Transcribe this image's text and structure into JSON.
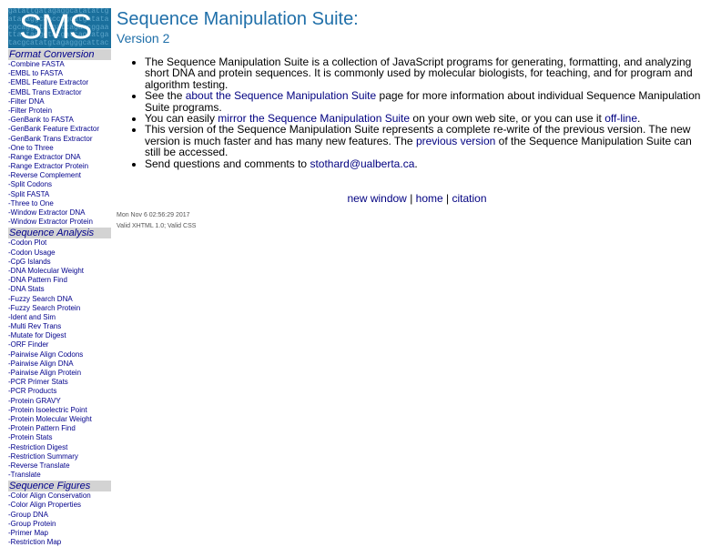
{
  "logo": {
    "text": "SMS",
    "background_sequence": "gatattgatagaggcatatattgatagaggcaaccggcatgatatacgcagggtatgatcagaccggaattattagggtatgatcagcatgatacgcatatgtagagggcattaccagggtagattgag",
    "bg_color": "#1a6f9c"
  },
  "sidebar": {
    "sections": [
      {
        "title": "Format Conversion",
        "items": [
          "-Combine FASTA",
          "-EMBL to FASTA",
          "-EMBL Feature Extractor",
          "-EMBL Trans Extractor",
          "-Filter DNA",
          "-Filter Protein",
          "-GenBank to FASTA",
          "-GenBank Feature Extractor",
          "-GenBank Trans Extractor",
          "-One to Three",
          "-Range Extractor DNA",
          "-Range Extractor Protein",
          "-Reverse Complement",
          "-Split Codons",
          "-Split FASTA",
          "-Three to One",
          "-Window Extractor DNA",
          "-Window Extractor Protein"
        ]
      },
      {
        "title": "Sequence Analysis",
        "items": [
          "-Codon Plot",
          "-Codon Usage",
          "-CpG Islands",
          "-DNA Molecular Weight",
          "-DNA Pattern Find",
          "-DNA Stats",
          "-Fuzzy Search DNA",
          "-Fuzzy Search Protein",
          "-Ident and Sim",
          "-Multi Rev Trans",
          "-Mutate for Digest",
          "-ORF Finder",
          "-Pairwise Align Codons",
          "-Pairwise Align DNA",
          "-Pairwise Align Protein",
          "-PCR Primer Stats",
          "-PCR Products",
          "-Protein GRAVY",
          "-Protein Isoelectric Point",
          "-Protein Molecular Weight",
          "-Protein Pattern Find",
          "-Protein Stats",
          "-Restriction Digest",
          "-Restriction Summary",
          "-Reverse Translate",
          "-Translate"
        ]
      },
      {
        "title": "Sequence Figures",
        "items": [
          "-Color Align Conservation",
          "-Color Align Properties",
          "-Group DNA",
          "-Group Protein",
          "-Primer Map",
          "-Restriction Map"
        ]
      }
    ]
  },
  "main": {
    "title": "Sequence Manipulation Suite:",
    "subtitle": "Version 2",
    "bullets": [
      [
        {
          "t": "The Sequence Manipulation Suite is a collection of JavaScript programs for generating, formatting, and analyzing short DNA and protein sequences. It is commonly used by molecular biologists, for teaching, and for program and algorithm testing."
        }
      ],
      [
        {
          "t": "See the "
        },
        {
          "t": "about the Sequence Manipulation Suite",
          "link": true
        },
        {
          "t": " page for more information about individual Sequence Manipulation Suite programs."
        }
      ],
      [
        {
          "t": "You can easily "
        },
        {
          "t": "mirror the Sequence Manipulation Suite",
          "link": true
        },
        {
          "t": " on your own web site, or you can use it "
        },
        {
          "t": "off-line",
          "link": true
        },
        {
          "t": "."
        }
      ],
      [
        {
          "t": "This version of the Sequence Manipulation Suite represents a complete re-write of the previous version. The new version is much faster and has many new features. The "
        },
        {
          "t": "previous version",
          "link": true
        },
        {
          "t": " of the Sequence Manipulation Suite can still be accessed."
        }
      ],
      [
        {
          "t": "Send questions and comments to "
        },
        {
          "t": "stothard@ualberta.ca",
          "link": true
        },
        {
          "t": "."
        }
      ]
    ],
    "bottom_links": [
      "new window",
      "home",
      "citation"
    ],
    "separator": "|",
    "timestamp": "Mon Nov 6 02:56:29 2017",
    "valid_text": "Valid XHTML 1.0; Valid CSS"
  },
  "colors": {
    "link": "#000080",
    "heading": "#1f6fa9",
    "section_bg": "#d3d3d3"
  }
}
